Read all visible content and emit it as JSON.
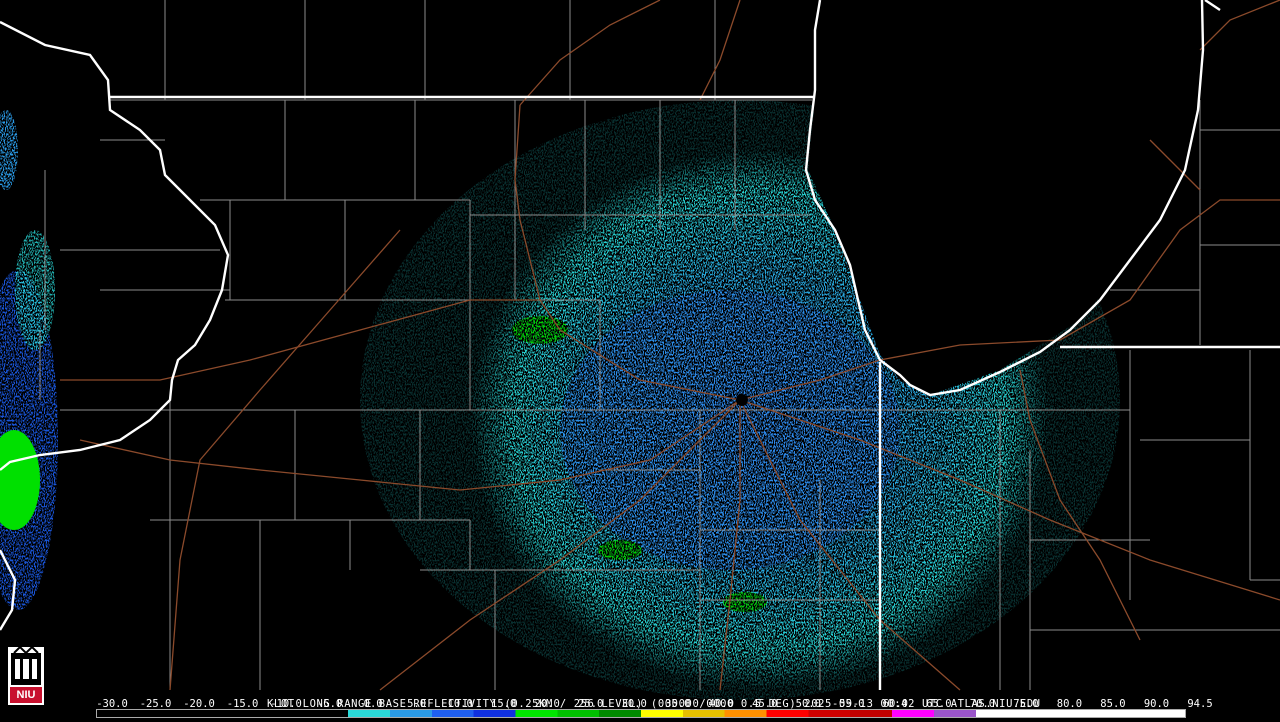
{
  "product": {
    "station": "KLOT",
    "name": "LONG RANGE BASE REFLECTIVITY",
    "resolution": "(0.25KM / 256 LEVEL)",
    "volume": "(000000/0000 0.5 DEG)",
    "datetime": "2025-09-13 00:42 UTC",
    "source": "ATLAS.NIU.EDU"
  },
  "logo": {
    "text": "NIU",
    "color": "#c8102e"
  },
  "scale": {
    "labels": [
      "-30.0",
      "-25.0",
      "-20.0",
      "-15.0",
      "-10.0",
      "-5.0",
      "0.0",
      "5.0",
      "10.0",
      "15.0",
      "20.0",
      "25.0",
      "30.0",
      "35.0",
      "40.0",
      "45.0",
      "50.0",
      "55.0",
      "60.0",
      "65.0",
      "70.0",
      "75.0",
      "80.0",
      "85.0",
      "90.0",
      "94.5"
    ],
    "colors": [
      "#000000",
      "#000000",
      "#000000",
      "#000000",
      "#000000",
      "#000000",
      "#2ad9d9",
      "#2a9ae6",
      "#1f5ff0",
      "#1030e0",
      "#00e600",
      "#00c000",
      "#008a00",
      "#ffff00",
      "#e6c000",
      "#ff9000",
      "#ff0000",
      "#d00000",
      "#c00000",
      "#ff00ff",
      "#9a55c9",
      "#ffffff",
      "#ffffff",
      "#ffffff",
      "#ffffff",
      "#ffffff"
    ]
  },
  "legend_colors": {
    "state_border": "#ffffff",
    "county_border": "#8c8c8c",
    "highway": "#8b4a2b",
    "radar_site": "#000000"
  }
}
